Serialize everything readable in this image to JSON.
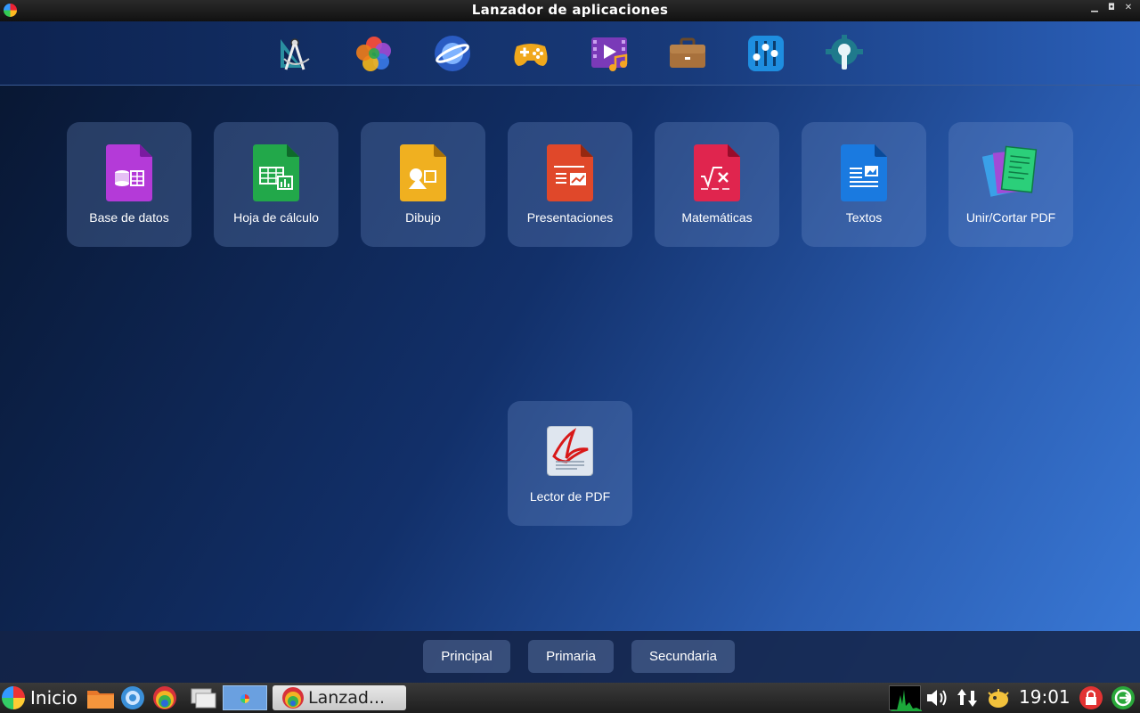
{
  "window": {
    "title": "Lanzador de aplicaciones"
  },
  "categories": [
    {
      "icon": "accessories-icon"
    },
    {
      "icon": "graphics-icon"
    },
    {
      "icon": "internet-icon"
    },
    {
      "icon": "games-icon"
    },
    {
      "icon": "multimedia-icon"
    },
    {
      "icon": "office-icon"
    },
    {
      "icon": "settings-icon"
    },
    {
      "icon": "system-icon"
    }
  ],
  "apps": [
    {
      "label": "Base de datos",
      "icon": "database-icon",
      "color": "#b43ad8"
    },
    {
      "label": "Hoja de cálculo",
      "icon": "spreadsheet-icon",
      "color": "#22a84a"
    },
    {
      "label": "Dibujo",
      "icon": "drawing-icon",
      "color": "#f0b020"
    },
    {
      "label": "Presentaciones",
      "icon": "presentation-icon",
      "color": "#e0482a"
    },
    {
      "label": "Matemáticas",
      "icon": "math-icon",
      "color": "#e0254e"
    },
    {
      "label": "Textos",
      "icon": "writer-icon",
      "color": "#1a7ae0"
    },
    {
      "label": "Unir/Cortar PDF",
      "icon": "pdf-split-icon",
      "color": "#2bcf7a"
    },
    {
      "label": "Lector de PDF",
      "icon": "pdf-reader-icon",
      "color": "#d81818"
    }
  ],
  "bottom_tabs": [
    "Principal",
    "Primaria",
    "Secundaria"
  ],
  "taskbar": {
    "start_label": "Inicio",
    "task_label": "Lanzad...",
    "clock": "19:01"
  }
}
